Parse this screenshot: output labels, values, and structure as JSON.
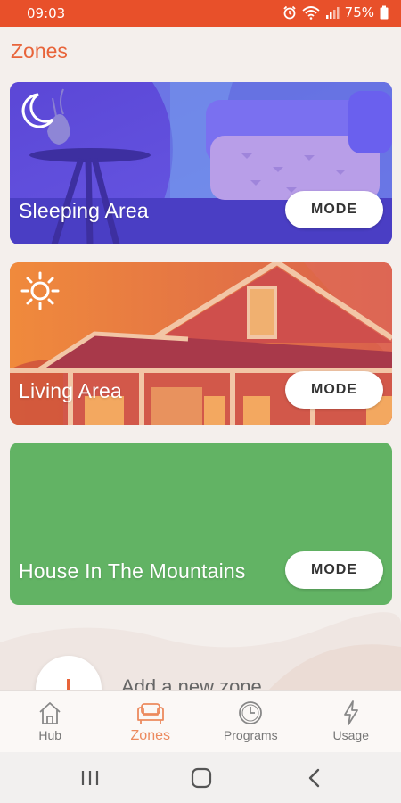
{
  "status_bar": {
    "time": "09:03",
    "battery_percent": "75%",
    "icons": [
      "alarm-icon",
      "wifi-icon",
      "signal-icon",
      "battery-icon"
    ]
  },
  "header": {
    "title": "Zones"
  },
  "zones": [
    {
      "name": "Sleeping Area",
      "mode_label": "MODE",
      "mode_icon": "moon-icon",
      "color": "#5a4ad8"
    },
    {
      "name": "Living Area",
      "mode_label": "MODE",
      "mode_icon": "sun-icon",
      "color": "#e8703a"
    },
    {
      "name": "House In The Mountains",
      "mode_label": "MODE",
      "color": "#62b364"
    }
  ],
  "add_zone": {
    "label": "Add a new zone"
  },
  "tab_bar": {
    "active": "Zones",
    "tabs": [
      {
        "label": "Hub",
        "icon": "home-icon"
      },
      {
        "label": "Zones",
        "icon": "sofa-icon"
      },
      {
        "label": "Programs",
        "icon": "clock-icon"
      },
      {
        "label": "Usage",
        "icon": "lightning-icon"
      }
    ]
  },
  "nav_bar": {
    "buttons": [
      "recents-icon",
      "home-button-icon",
      "back-icon"
    ]
  },
  "colors": {
    "accent": "#e8643a",
    "status_bar": "#e8502a",
    "tab_active": "#ec8a5e"
  }
}
